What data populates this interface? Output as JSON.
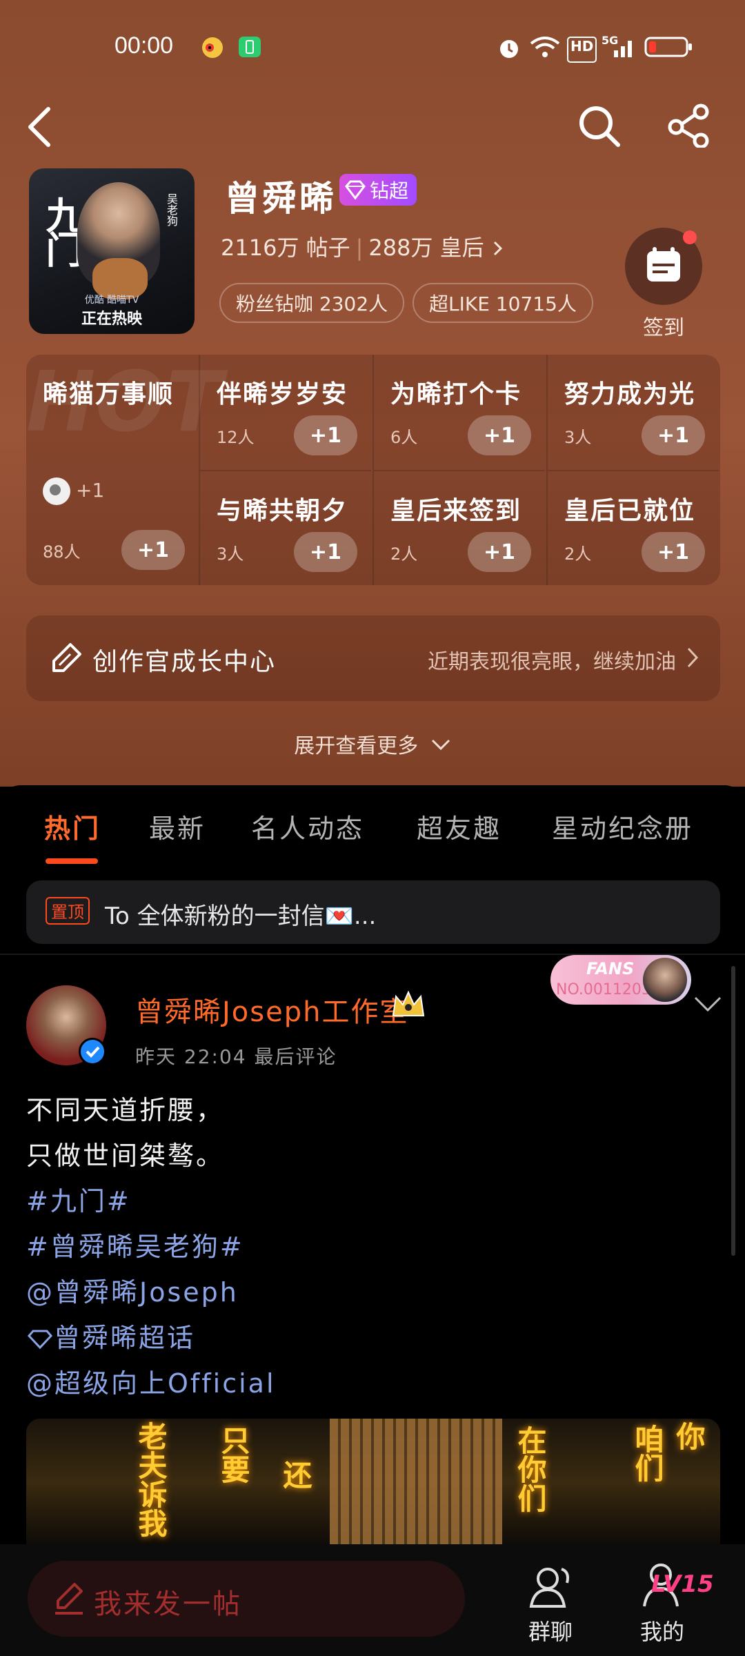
{
  "status_bar": {
    "time": "00:00",
    "network": "5G",
    "hd": "HD"
  },
  "topic": {
    "name": "曾舜晞",
    "badge": "钻超",
    "posts": "2116万 帖子",
    "followers": "288万 皇后",
    "fan_pill": "粉丝钻咖 2302人",
    "like_pill": "超LIKE 10715人",
    "checkin_label": "签到",
    "cover": {
      "title": "九门",
      "caption": "正在热映",
      "vertical_text": "吴老狗",
      "sponsors": "优酷 酷喵TV"
    }
  },
  "checkin_grid": {
    "hot_word": "HOT",
    "first": {
      "title": "晞猫万事顺",
      "count": "88人",
      "plus": "+1",
      "mini_plus": "+1"
    },
    "cells": [
      {
        "title": "伴晞岁岁安",
        "count": "12人",
        "plus": "+1"
      },
      {
        "title": "为晞打个卡",
        "count": "6人",
        "plus": "+1"
      },
      {
        "title": "努力成为光",
        "count": "3人",
        "plus": "+1"
      },
      {
        "title": "与晞共朝夕",
        "count": "3人",
        "plus": "+1"
      },
      {
        "title": "皇后来签到",
        "count": "2人",
        "plus": "+1"
      },
      {
        "title": "皇后已就位",
        "count": "2人",
        "plus": "+1"
      }
    ]
  },
  "creator_center": {
    "title": "创作官成长中心",
    "message": "近期表现很亮眼，继续加油"
  },
  "expand_more": "展开查看更多",
  "tabs": [
    "热门",
    "最新",
    "名人动态",
    "超友趣",
    "星动纪念册"
  ],
  "pinned": {
    "tag": "置顶",
    "text": "To 全体新粉的一封信💌..."
  },
  "post": {
    "author": "曾舜晞Joseph工作室",
    "time": "昨天 22:04 最后评论",
    "fans_badge": {
      "line1": "FANS",
      "line2": "NO.0011203"
    },
    "lines": [
      {
        "text": "不同天道折腰，",
        "link": false
      },
      {
        "text": "只做世间桀骜。",
        "link": false
      },
      {
        "text": "#九门#",
        "link": true
      },
      {
        "text": "#曾舜晞吴老狗#",
        "link": true
      },
      {
        "text": "@曾舜晞Joseph",
        "link": true
      },
      {
        "text": "曾舜晞超话",
        "link": true
      },
      {
        "text": "@超级向上Official",
        "link": true
      }
    ],
    "image_texts": [
      "老夫诉我",
      "只要",
      "还",
      "在你们",
      "咱们",
      "你"
    ]
  },
  "bottom_bar": {
    "compose": "我来发一帖",
    "group_chat": "群聊",
    "mine": "我的",
    "level": "LV15"
  },
  "colors": {
    "accent": "#ff6b2c",
    "header_bg": "#9a5438",
    "link": "#8ba4e6"
  }
}
